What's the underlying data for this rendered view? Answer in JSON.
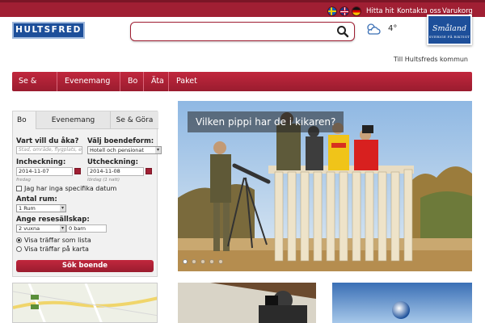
{
  "topbar": {
    "languages": [
      "swedish-flag",
      "english-flag",
      "german-flag"
    ],
    "links": [
      "Hitta hit",
      "Kontakta oss",
      "Varukorg"
    ]
  },
  "logo": {
    "text": "HULTSFRED"
  },
  "search": {
    "placeholder": "",
    "value": ""
  },
  "weather": {
    "icon": "partly-cloudy-icon",
    "temperature": "4°"
  },
  "brand_badge": {
    "line1": "Småland",
    "line2": "SVERIGE PÅ RIKTIGT"
  },
  "kommun_link": "Till Hultsfreds kommun",
  "nav": [
    "Se & göra",
    "Evenemang",
    "Bo",
    "Äta",
    "Paket"
  ],
  "booking": {
    "tabs": [
      "Bo",
      "Evenemang",
      "Se & Göra"
    ],
    "where_label": "Vart vill du åka?",
    "where_placeholder": "Stad, område, flygplats, el",
    "type_label": "Välj boendeform:",
    "type_value": "Hotell och pensionat",
    "checkin_label": "Incheckning:",
    "checkin_value": "2014-11-07",
    "checkin_day": "fredag",
    "checkout_label": "Utcheckning:",
    "checkout_value": "2014-11-08",
    "checkout_day": "lördag (1 natt)",
    "no_dates_label": "Jag har inga specifika datum",
    "rooms_label": "Antal rum:",
    "rooms_value": "1 Rum",
    "ages_label": "Ange resesällskap:",
    "adults_value": "2 vuxna",
    "children_value": "0 barn",
    "view_list": "Visa träffar som lista",
    "view_map": "Visa träffar på karta",
    "submit": "Sök boende"
  },
  "hero": {
    "caption": "Vilken pippi har de i kikaren?",
    "slide_count": 5,
    "active_slide": 1
  },
  "colors": {
    "brand_red": "#a01f33",
    "brand_blue": "#1d4f9a"
  }
}
